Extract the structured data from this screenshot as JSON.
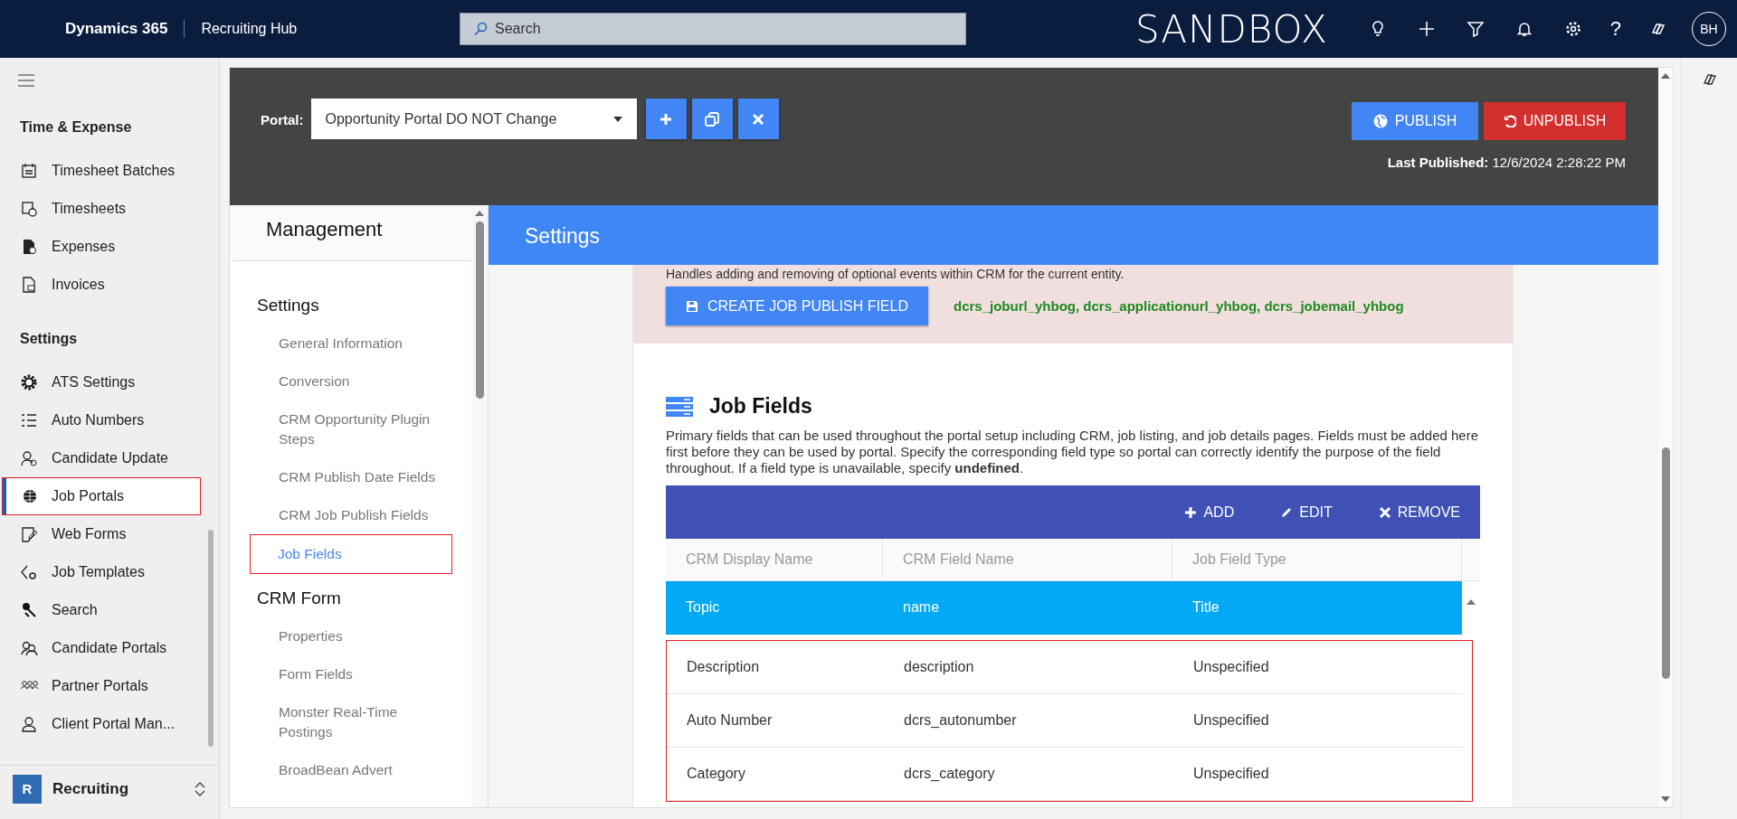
{
  "top_bar": {
    "app_name": "Dynamics 365",
    "area": "Recruiting Hub",
    "search": {
      "placeholder": "Search"
    },
    "environment": "SANDBOX",
    "help_glyph": "?",
    "avatar": "BH"
  },
  "sidebar": {
    "groups": [
      {
        "title": "Time & Expense",
        "items": [
          {
            "label": "Timesheet Batches",
            "selected": false,
            "highlighted": false
          },
          {
            "label": "Timesheets",
            "selected": false,
            "highlighted": false
          },
          {
            "label": "Expenses",
            "selected": false,
            "highlighted": false
          },
          {
            "label": "Invoices",
            "selected": false,
            "highlighted": false
          }
        ]
      },
      {
        "title": "Settings",
        "items": [
          {
            "label": "ATS Settings",
            "selected": false,
            "highlighted": false
          },
          {
            "label": "Auto Numbers",
            "selected": false,
            "highlighted": false
          },
          {
            "label": "Candidate Update",
            "selected": false,
            "highlighted": false
          },
          {
            "label": "Job Portals",
            "selected": true,
            "highlighted": true
          },
          {
            "label": "Web Forms",
            "selected": false,
            "highlighted": false
          },
          {
            "label": "Job Templates",
            "selected": false,
            "highlighted": false
          },
          {
            "label": "Search",
            "selected": false,
            "highlighted": false
          },
          {
            "label": "Candidate Portals",
            "selected": false,
            "highlighted": false
          },
          {
            "label": "Partner Portals",
            "selected": false,
            "highlighted": false
          },
          {
            "label": "Client Portal Man...",
            "selected": false,
            "highlighted": false
          }
        ]
      }
    ],
    "area_switcher": {
      "badge": "R",
      "label": "Recruiting"
    }
  },
  "portal_header": {
    "label": "Portal:",
    "portal": "Opportunity Portal DO NOT Change",
    "publish": "PUBLISH",
    "unpublish": "UNPUBLISH",
    "last_published_label": "Last Published:",
    "last_published": "12/6/2024 2:28:22 PM"
  },
  "management": {
    "title": "Management",
    "sections": [
      {
        "title": "Settings",
        "items": [
          {
            "label": "General Information",
            "selected": false,
            "highlighted": false
          },
          {
            "label": "Conversion",
            "selected": false,
            "highlighted": false
          },
          {
            "label": "CRM Opportunity Plugin Steps",
            "selected": false,
            "highlighted": false
          },
          {
            "label": "CRM Publish Date Fields",
            "selected": false,
            "highlighted": false
          },
          {
            "label": "CRM Job Publish Fields",
            "selected": false,
            "highlighted": false
          },
          {
            "label": "Job Fields",
            "selected": true,
            "highlighted": true
          }
        ]
      },
      {
        "title": "CRM Form",
        "items": [
          {
            "label": "Properties",
            "selected": false,
            "highlighted": false
          },
          {
            "label": "Form Fields",
            "selected": false,
            "highlighted": false
          },
          {
            "label": "Monster Real-Time Postings",
            "selected": false,
            "highlighted": false
          },
          {
            "label": "BroadBean Advert",
            "selected": false,
            "highlighted": false
          }
        ]
      }
    ]
  },
  "settings": {
    "title": "Settings",
    "publish_fields": {
      "note": "Handles adding and removing of optional events within CRM for the current entity.",
      "button": "CREATE JOB PUBLISH FIELD",
      "fields": "dcrs_joburl_yhbog, dcrs_applicationurl_yhbog, dcrs_jobemail_yhbog"
    },
    "job_fields": {
      "title": "Job Fields",
      "description": "Primary fields that can be used throughout the portal setup including CRM, job listing, and job details pages. Fields must be added here first before they can be used by portal. Specify the corresponding field type so portal can correctly identify the purpose of the field throughout. If a field type is unavailable, specify **undefined**.",
      "actions": [
        {
          "kind": "add",
          "label": "ADD"
        },
        {
          "kind": "edit",
          "label": "EDIT"
        },
        {
          "kind": "remove",
          "label": "REMOVE"
        }
      ],
      "columns": [
        "CRM Display Name",
        "CRM Field Name",
        "Job Field Type"
      ],
      "rows": [
        {
          "cells": [
            "Topic",
            "name",
            "Title"
          ],
          "selected": true,
          "highlighted": false
        },
        {
          "cells": [
            "Description",
            "description",
            "Unspecified"
          ],
          "selected": false,
          "highlighted": true
        },
        {
          "cells": [
            "Auto Number",
            "dcrs_autonumber",
            "Unspecified"
          ],
          "selected": false,
          "highlighted": true
        },
        {
          "cells": [
            "Category",
            "dcrs_category",
            "Unspecified"
          ],
          "selected": false,
          "highlighted": true
        }
      ]
    }
  }
}
